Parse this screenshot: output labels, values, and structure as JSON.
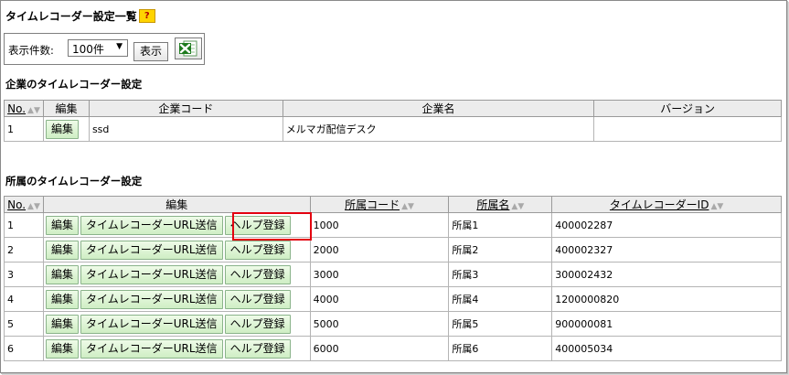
{
  "page": {
    "title": "タイムレコーダー設定一覧",
    "help_icon_label": "?"
  },
  "controls": {
    "count_label": "表示件数:",
    "count_value": "100件",
    "show_button": "表示",
    "excel_icon": "excel-export-icon"
  },
  "company_section": {
    "title": "企業のタイムレコーダー設定",
    "headers": {
      "no": "No.",
      "edit": "編集",
      "code": "企業コード",
      "name": "企業名",
      "version": "バージョン"
    },
    "rows": [
      {
        "no": "1",
        "edit": "編集",
        "code": "ssd",
        "name": "メルマガ配信デスク",
        "version": ""
      }
    ]
  },
  "dept_section": {
    "title": "所属のタイムレコーダー設定",
    "headers": {
      "no": "No.",
      "edit": "編集",
      "code": "所属コード",
      "name": "所属名",
      "id": "タイムレコーダーID"
    },
    "buttons": {
      "edit": "編集",
      "url_send": "タイムレコーダーURL送信",
      "help_register": "ヘルプ登録"
    },
    "rows": [
      {
        "no": "1",
        "code": "1000",
        "name": "所属1",
        "id": "400002287"
      },
      {
        "no": "2",
        "code": "2000",
        "name": "所属2",
        "id": "400002327"
      },
      {
        "no": "3",
        "code": "3000",
        "name": "所属3",
        "id": "300002432"
      },
      {
        "no": "4",
        "code": "4000",
        "name": "所属4",
        "id": "1200000820"
      },
      {
        "no": "5",
        "code": "5000",
        "name": "所属5",
        "id": "900000081"
      },
      {
        "no": "6",
        "code": "6000",
        "name": "所属6",
        "id": "400005034"
      }
    ]
  }
}
